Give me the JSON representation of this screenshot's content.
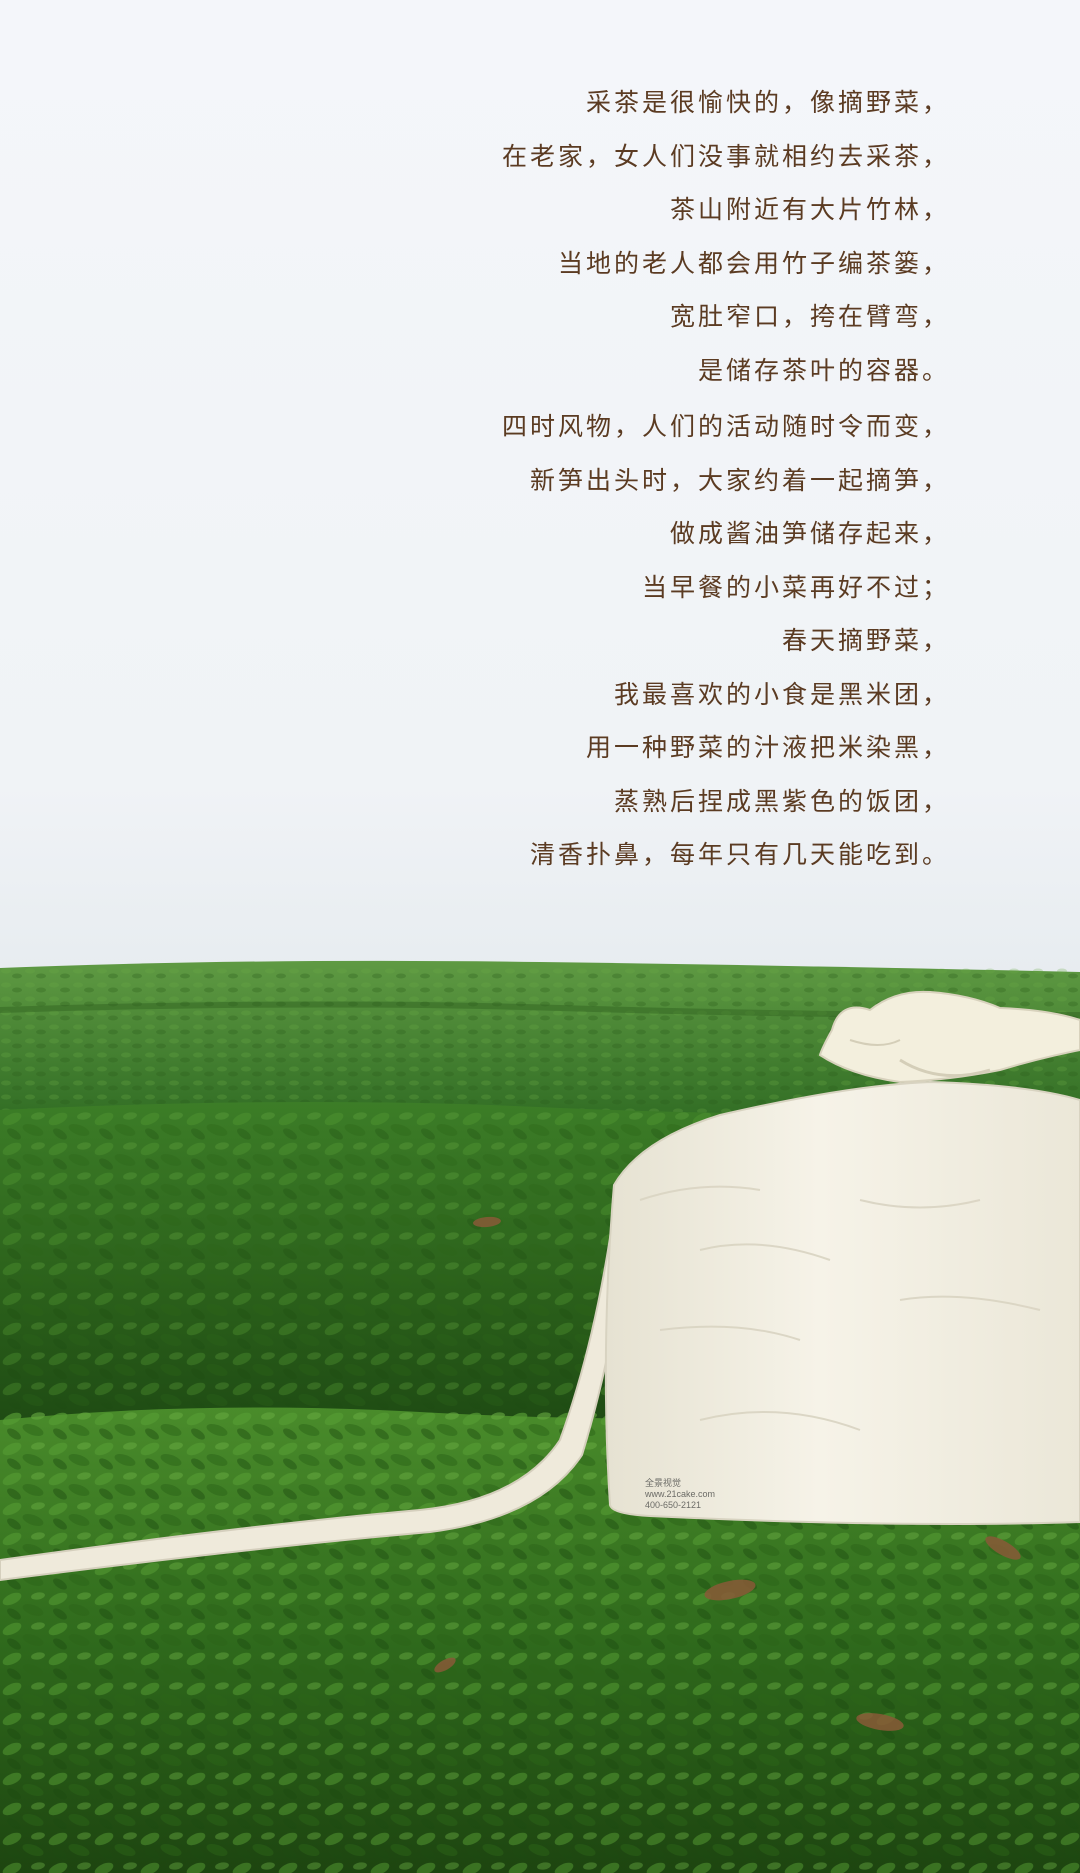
{
  "poem": {
    "stanza_1": [
      "采茶是很愉快的，像摘野菜，",
      "在老家，女人们没事就相约去采茶，",
      "茶山附近有大片竹林，",
      "当地的老人都会用竹子编茶篓，",
      "宽肚窄口，挎在臂弯，",
      "是储存茶叶的容器。"
    ],
    "stanza_2": [
      "四时风物，人们的活动随时令而变，",
      "新笋出头时，大家约着一起摘笋，",
      "做成酱油笋储存起来，",
      "当早餐的小菜再好不过；",
      "春天摘野菜，",
      "我最喜欢的小食是黑米团，",
      "用一种野菜的汁液把米染黑，",
      "蒸熟后捏成黑紫色的饭团，",
      "清香扑鼻，每年只有几天能吃到。"
    ]
  },
  "watermark": {
    "line_1": "全景视觉",
    "line_2": "www.21cake.com",
    "line_3": "400-650-2121"
  },
  "colors": {
    "text": "#5b3b22",
    "sky_top": "#f4f6fa",
    "sky_bottom": "#eef2f5",
    "tea_bush_light": "#4f8f2f",
    "tea_bush_dark": "#1f4d14",
    "cloth_bag": "#f2efe2"
  }
}
